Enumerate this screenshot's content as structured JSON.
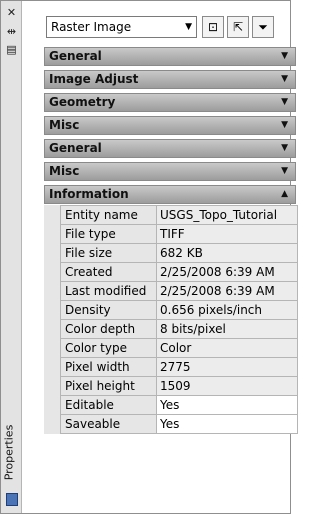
{
  "palette": {
    "title": "Properties"
  },
  "selector": {
    "selected": "Raster Image"
  },
  "sections": [
    {
      "label": "General"
    },
    {
      "label": "Image Adjust"
    },
    {
      "label": "Geometry"
    },
    {
      "label": "Misc"
    },
    {
      "label": "General"
    },
    {
      "label": "Misc"
    },
    {
      "label": "Information"
    }
  ],
  "information": {
    "rows": [
      {
        "name": "Entity name",
        "value": "USGS_Topo_Tutorial"
      },
      {
        "name": "File type",
        "value": "TIFF"
      },
      {
        "name": "File size",
        "value": "682 KB"
      },
      {
        "name": "Created",
        "value": "2/25/2008 6:39 AM"
      },
      {
        "name": "Last modified",
        "value": "2/25/2008 6:39 AM"
      },
      {
        "name": "Density",
        "value": "0.656 pixels/inch"
      },
      {
        "name": "Color depth",
        "value": "8 bits/pixel"
      },
      {
        "name": "Color type",
        "value": "Color"
      },
      {
        "name": "Pixel width",
        "value": "2775"
      },
      {
        "name": "Pixel height",
        "value": "1509"
      },
      {
        "name": "Editable",
        "value": "Yes"
      },
      {
        "name": "Saveable",
        "value": "Yes"
      }
    ]
  },
  "icons": {
    "close": "close-icon",
    "autohide": "autohide-icon",
    "menu": "properties-menu-icon",
    "dropdown": "chevron-down-icon",
    "quick_select": "quick-select-icon",
    "select_objects": "select-objects-icon",
    "pickadd": "pickadd-toggle-icon",
    "collapse": "chevron-down-icon",
    "expand": "chevron-up-icon"
  }
}
